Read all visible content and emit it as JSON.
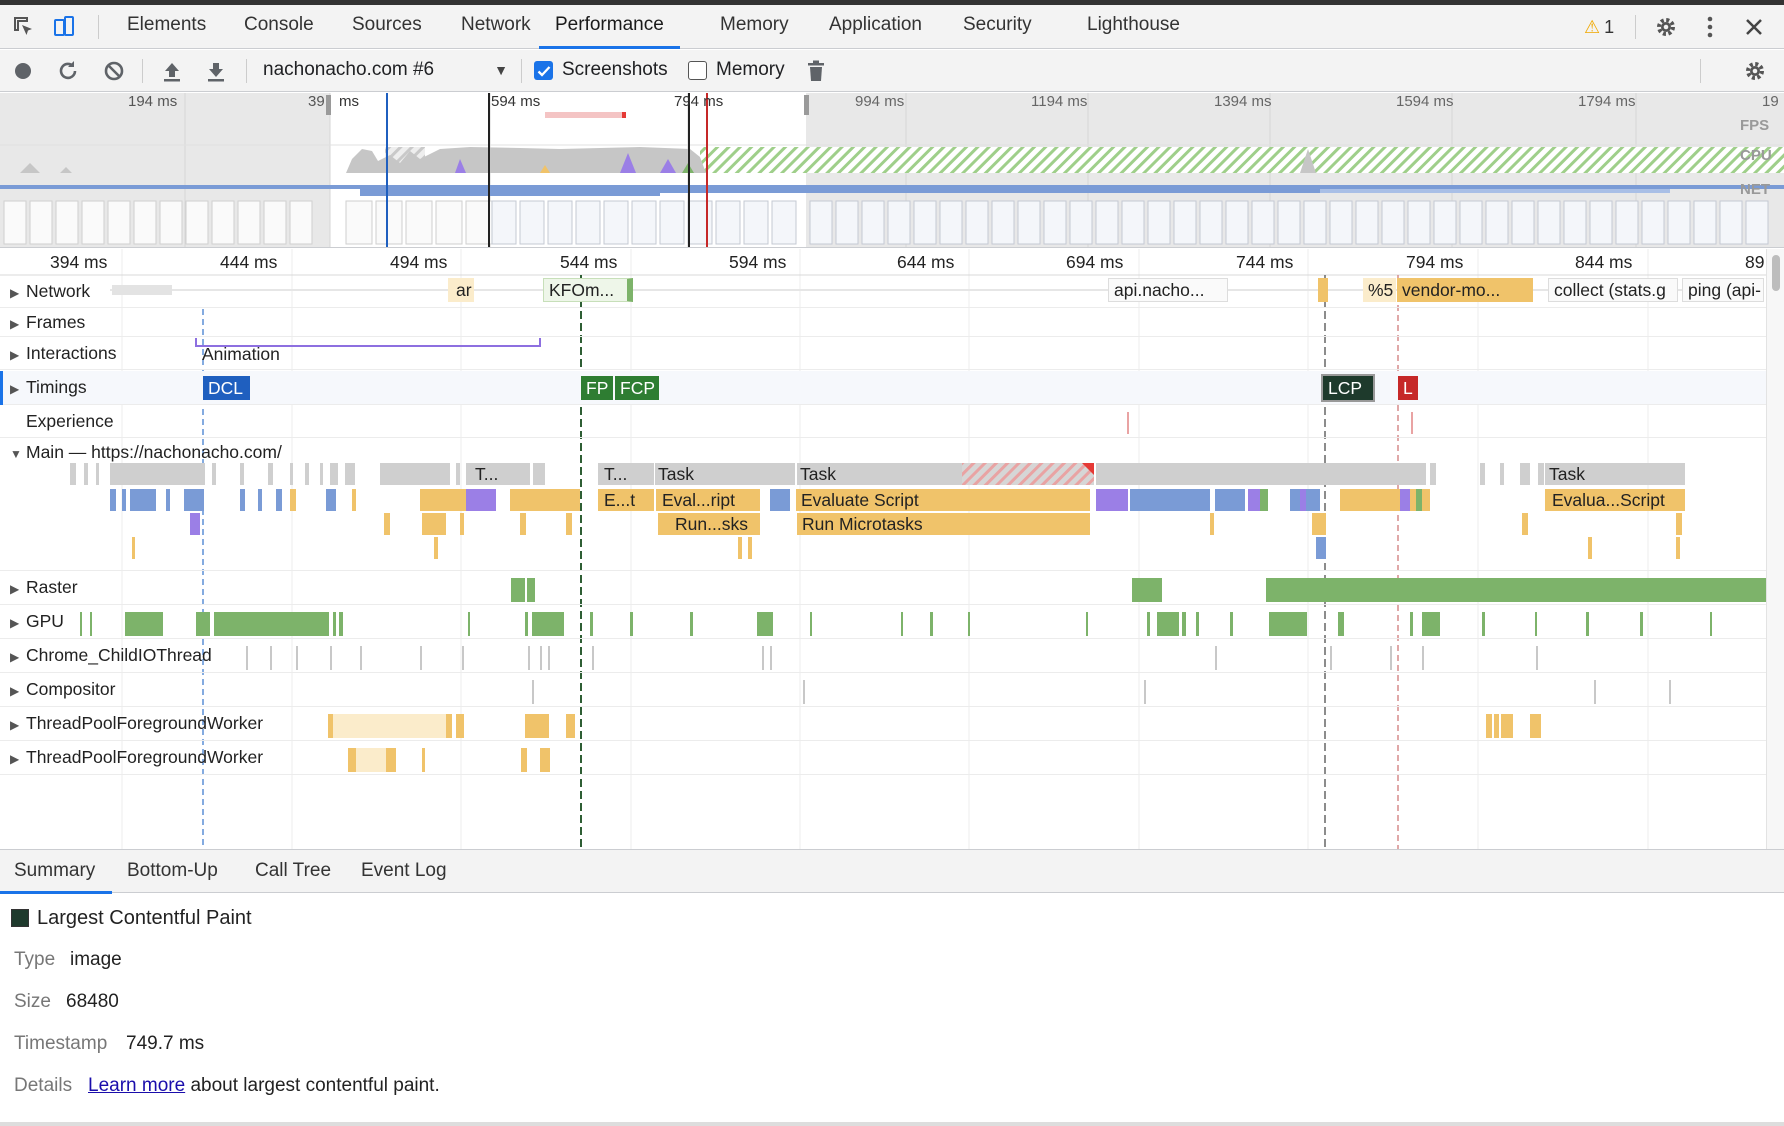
{
  "tabs": {
    "items": [
      "Elements",
      "Console",
      "Sources",
      "Network",
      "Performance",
      "Memory",
      "Application",
      "Security",
      "Lighthouse"
    ],
    "active": "Performance",
    "warning_count": "1"
  },
  "toolbar": {
    "profile_select": "nachonacho.com #6",
    "screenshots_label": "Screenshots",
    "screenshots_checked": true,
    "memory_label": "Memory",
    "memory_checked": false
  },
  "overview": {
    "ticks": [
      "194 ms",
      "39",
      "ms",
      "594 ms",
      "794 ms",
      "994 ms",
      "1194 ms",
      "1394 ms",
      "1594 ms",
      "1794 ms",
      "19"
    ],
    "labels": {
      "fps": "FPS",
      "cpu": "CPU",
      "net": "NET"
    }
  },
  "ruler": [
    "394 ms",
    "444 ms",
    "494 ms",
    "544 ms",
    "594 ms",
    "644 ms",
    "694 ms",
    "744 ms",
    "794 ms",
    "844 ms",
    "89"
  ],
  "tracks": {
    "network": "Network",
    "frames": "Frames",
    "interactions": "Interactions",
    "timings": "Timings",
    "experience": "Experience",
    "main": "Main — https://nachonacho.com/",
    "raster": "Raster",
    "gpu": "GPU",
    "child_io": "Chrome_ChildIOThread",
    "compositor": "Compositor",
    "threadpool1": "ThreadPoolForegroundWorker",
    "threadpool2": "ThreadPoolForegroundWorker"
  },
  "network_bars": [
    "ar",
    "KFOm...",
    "api.nacho...",
    "%5",
    "vendor-mo...",
    "collect (stats.g",
    "ping (api-"
  ],
  "interaction_label": "Animation",
  "timing_markers": [
    "DCL",
    "FP",
    "FCP",
    "LCP",
    "L"
  ],
  "main_tasks": {
    "row1": [
      "T...",
      "T...",
      "Task",
      "Task",
      "Task"
    ],
    "row2": [
      "E...t",
      "Eval...ript",
      "Evaluate Script",
      "Evalua...Script"
    ],
    "row3": [
      "Run...sks",
      "Run Microtasks"
    ]
  },
  "bottom_tabs": {
    "items": [
      "Summary",
      "Bottom-Up",
      "Call Tree",
      "Event Log"
    ],
    "active": "Summary"
  },
  "summary": {
    "title": "Largest Contentful Paint",
    "type_label": "Type",
    "type_value": "image",
    "size_label": "Size",
    "size_value": "68480",
    "timestamp_label": "Timestamp",
    "timestamp_value": "749.7 ms",
    "details_label": "Details",
    "details_link": "Learn more",
    "details_text": "about largest contentful paint."
  },
  "colors": {
    "accent": "#1a73e8",
    "scripting": "#f0c36a",
    "rendering": "#9b7fe6",
    "painting": "#7db36a",
    "system": "#c8c8c8",
    "loading": "#7a9bd6",
    "lcp": "#1e3a2c",
    "fp": "#2e7d32",
    "dcl": "#1f5fbf",
    "l": "#c62828"
  }
}
